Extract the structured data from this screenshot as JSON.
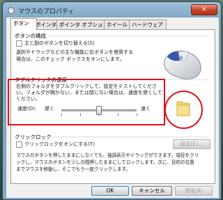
{
  "window": {
    "title": "マウスのプロパティ",
    "close_label": "×"
  },
  "tabs": [
    {
      "label": "ボタン",
      "active": true
    },
    {
      "label": "ポインタ"
    },
    {
      "label": "ポインタ オプション"
    },
    {
      "label": "ホイール"
    },
    {
      "label": "ハードウェア"
    }
  ],
  "button_config": {
    "heading": "ボタンの構成",
    "swap_label": "主と副のボタンを切り替える(S)",
    "swap_checked": false,
    "description_line1": "選択やドラッグなどの主な機能に右ボタンを使用する",
    "description_line2": "場合は、このチェック ボックスをオンにします。"
  },
  "double_click": {
    "heading": "ダブルクリックの速度",
    "description_line1": "右側のフォルダをダブルクリックして、設定をテストしてくださ",
    "description_line2": "い。フォルダが開かない、または閉じない場合は、速度を遅くして",
    "description_line3": "ください。",
    "speed_label": "速度(D):",
    "slow_label": "遅く",
    "fast_label": "速く",
    "slider_level": 0.5
  },
  "click_lock": {
    "heading": "クリックロック",
    "checkbox_label": "クリックロックをオンにする(T)",
    "checked": false,
    "settings_button": "設定(E)...",
    "description_line1": "マウスのボタンを押したままにしなくても、強調表示やドラッグができます。項目をクリ",
    "description_line2": "ックし、マウスのボタンを少しの間押したままにしてロックします。次に、目的の位置",
    "description_line3": "までマウスを移動し、そこでもう一度クリックします。"
  },
  "footer": {
    "ok_label": "OK",
    "cancel_label": "キャンセル",
    "apply_label": "適用(A)"
  },
  "colors": {
    "highlight_red": "#e0101a",
    "accent_blue": "#3c7fb1"
  }
}
